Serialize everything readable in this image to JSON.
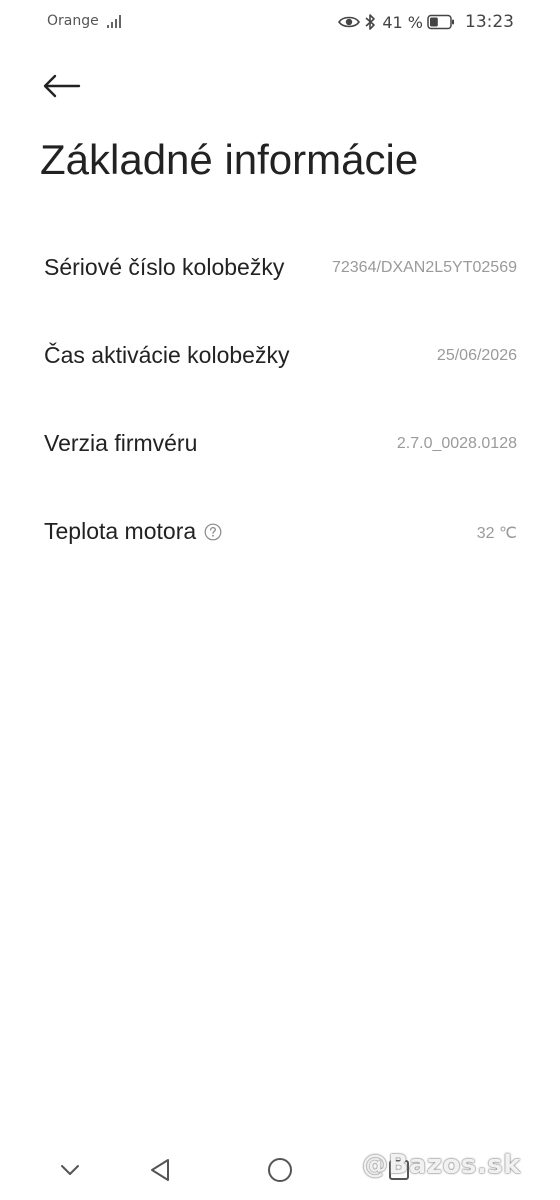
{
  "status_bar": {
    "carrier": "Orange",
    "signal_icon": "signal-bars-icon",
    "eye_icon": "eye-icon",
    "bluetooth_icon": "bluetooth-icon",
    "battery_percent": "41 %",
    "battery_level": 0.41,
    "time": "13:23"
  },
  "header": {
    "back_icon": "back-arrow-icon",
    "title": "Základné informácie"
  },
  "info": {
    "rows": [
      {
        "label": "Sériové číslo kolobežky",
        "value": "72364/DXAN2L5YT02569"
      },
      {
        "label": "Čas aktivácie kolobežky",
        "value": "25/06/2026"
      },
      {
        "label": "Verzia firmvéru",
        "value": "2.7.0_0028.0128"
      },
      {
        "label": "Teplota motora",
        "value": "32 ℃",
        "help_icon": "question-circle-icon"
      }
    ]
  },
  "nav_bar": {
    "collapse_icon": "chevron-down-icon",
    "back_icon": "triangle-back-icon",
    "home_icon": "circle-home-icon",
    "recents_icon": "square-recents-icon"
  },
  "watermark": {
    "text": "@Bazos.sk"
  }
}
